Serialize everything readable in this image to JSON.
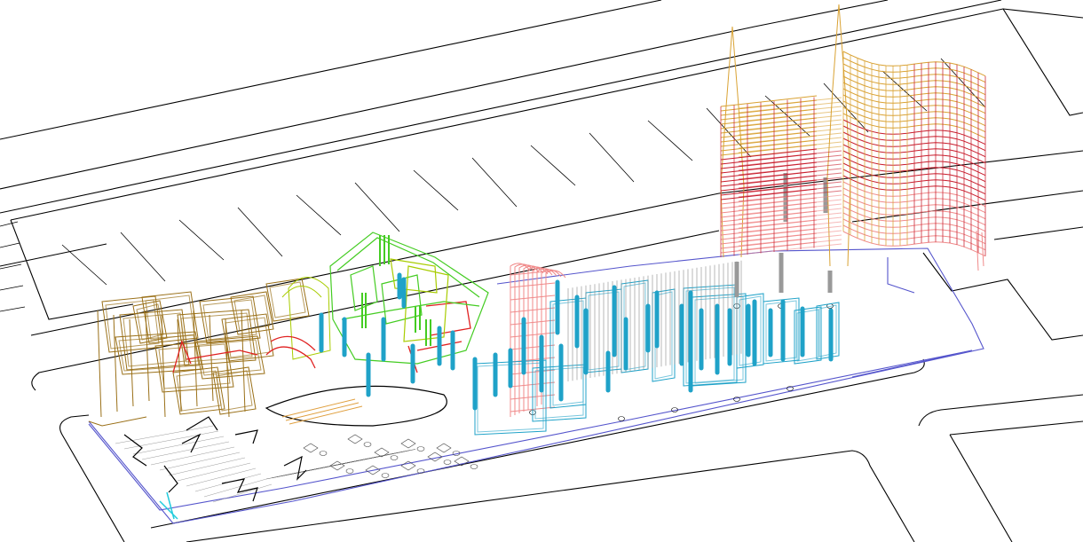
{
  "view": {
    "projection": "axonometric",
    "style": "wireframe",
    "background": "#ffffff"
  },
  "palette": {
    "site_lines": "#000000",
    "site_boundary": "#5555cc",
    "hatch_gray": "#8a8a8a",
    "building_brown": "#9a7018",
    "accent_red": "#e02020",
    "tower_gold": "#d9a233",
    "tower_red": "#c81c2c",
    "tower_pink": "#f08a8a",
    "greenhouse_green": "#44cc22",
    "greenhouse_lime": "#a8cc00",
    "column_cyan": "#1fa2c8",
    "column_gray": "#999999",
    "accent_cyan": "#22ccdd"
  },
  "layers": [
    {
      "name": "street-grid",
      "color": "#000000"
    },
    {
      "name": "site-boundary",
      "color": "#5555cc"
    },
    {
      "name": "west-building-frames",
      "color": "#9a7018"
    },
    {
      "name": "greenhouse-enclosure",
      "color": "#44cc22"
    },
    {
      "name": "east-columns",
      "color": "#1fa2c8"
    },
    {
      "name": "curtain-wall-towers",
      "color": "#d9a233"
    }
  ],
  "labels": []
}
